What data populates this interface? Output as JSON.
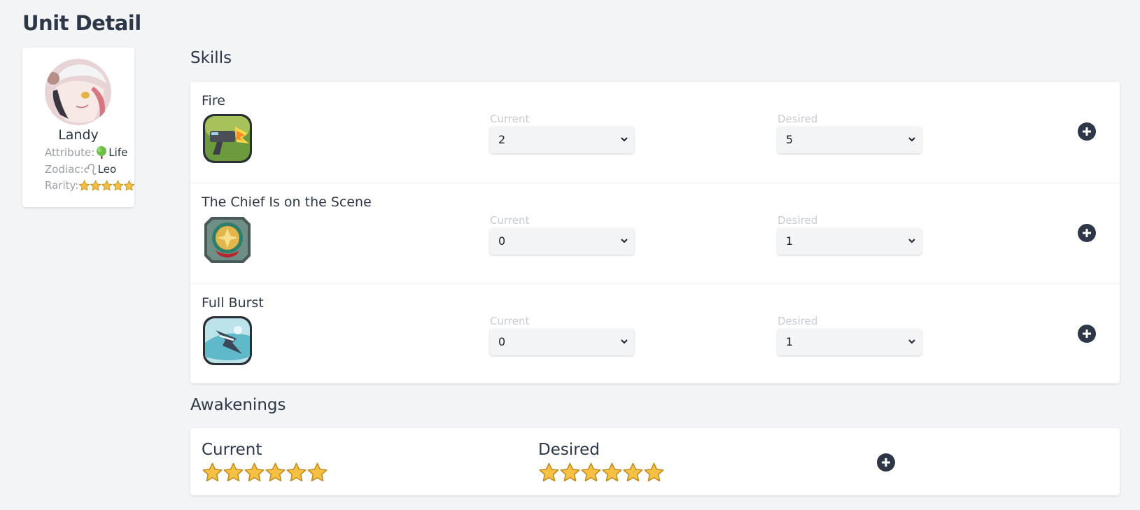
{
  "page": {
    "title": "Unit Detail"
  },
  "unit": {
    "name": "Landy",
    "attribute_label": "Attribute:",
    "attribute_value": "Life",
    "zodiac_label": "Zodiac:",
    "zodiac_value": "Leo",
    "rarity_label": "Rarity:",
    "rarity_stars": 5
  },
  "skills": {
    "title": "Skills",
    "current_label": "Current",
    "desired_label": "Desired",
    "items": [
      {
        "name": "Fire",
        "icon": "fire-skill-icon",
        "current": "2",
        "desired": "5"
      },
      {
        "name": "The Chief Is on the Scene",
        "icon": "chief-badge-skill-icon",
        "current": "0",
        "desired": "1"
      },
      {
        "name": "Full Burst",
        "icon": "full-burst-skill-icon",
        "current": "0",
        "desired": "1"
      }
    ]
  },
  "awakenings": {
    "title": "Awakenings",
    "current_label": "Current",
    "desired_label": "Desired",
    "current_stars": 6,
    "desired_stars": 6
  },
  "colors": {
    "background": "#f3f4f6",
    "text": "#2d3748",
    "muted": "#9aa0a6",
    "star": "#f6c142",
    "button": "#2d3748"
  }
}
